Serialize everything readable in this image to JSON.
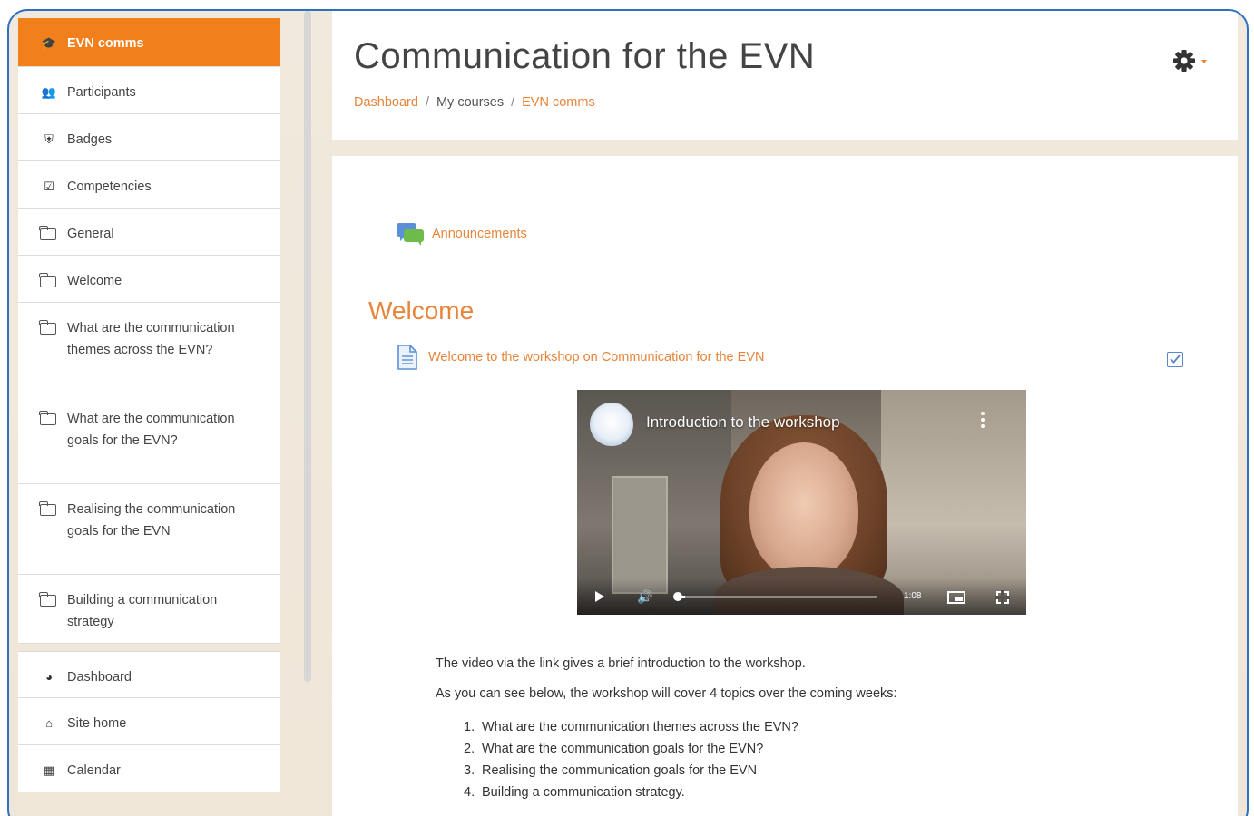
{
  "sidebar": {
    "items": [
      {
        "label": "EVN comms",
        "icon": "graduation-cap-icon",
        "active": true
      },
      {
        "label": "Participants",
        "icon": "users-icon"
      },
      {
        "label": "Badges",
        "icon": "shield-icon"
      },
      {
        "label": "Competencies",
        "icon": "checkbox-icon"
      },
      {
        "label": "General",
        "icon": "folder-icon"
      },
      {
        "label": "Welcome",
        "icon": "folder-icon"
      },
      {
        "label": "What are the communication themes across the EVN?",
        "icon": "folder-icon"
      },
      {
        "label": "What are the communication goals for the EVN?",
        "icon": "folder-icon"
      },
      {
        "label": "Realising the communication goals for the EVN",
        "icon": "folder-icon"
      },
      {
        "label": "Building a communication strategy",
        "icon": "folder-icon"
      },
      {
        "label": "Dashboard",
        "icon": "tachometer-icon"
      },
      {
        "label": "Site home",
        "icon": "home-icon"
      },
      {
        "label": "Calendar",
        "icon": "calendar-icon"
      }
    ]
  },
  "header": {
    "title": "Communication for the EVN",
    "breadcrumb": [
      "Dashboard",
      "My courses",
      "EVN comms"
    ]
  },
  "content": {
    "announcements_label": "Announcements",
    "section_title": "Welcome",
    "activity_label": "Welcome to the workshop on Communication for the EVN",
    "video": {
      "title": "Introduction to the workshop",
      "time": "1:08",
      "progress": 0.04
    },
    "intro_text": "The video via the link gives a brief introduction to the workshop.",
    "topics_intro": "As you can see below, the workshop will cover 4 topics over the coming weeks:",
    "topics": [
      "What are the communication themes across the EVN?",
      "What are the communication goals for the EVN?",
      "Realising the communication goals for the EVN",
      "Building a communication strategy."
    ]
  },
  "colors": {
    "accent": "#f07f1c",
    "link": "#e8843a",
    "frame_border": "#2e6fc0",
    "background": "#efe6d8"
  }
}
